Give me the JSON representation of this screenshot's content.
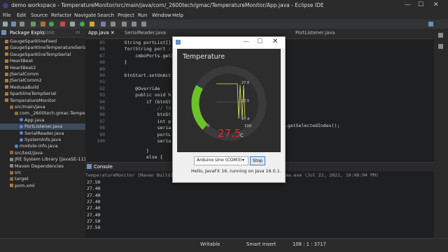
{
  "window": {
    "title": "demo workspace - TemperatureMonitor/src/main/java/com/_2600tech/gmac/TemperatureMonitor/App.java - Eclipse IDE"
  },
  "menu": [
    "File",
    "Edit",
    "Source",
    "Refactor",
    "Navigate",
    "Search",
    "Project",
    "Run",
    "Window",
    "Help"
  ],
  "left_panel": {
    "tab_label": "Package Explo",
    "tab2_label": "JUnit",
    "tree": [
      {
        "label": "GaugeSparklineFeed",
        "indent": 1,
        "icon": "project"
      },
      {
        "label": "GaugeSparklineTemperatureSerial",
        "indent": 1,
        "icon": "project"
      },
      {
        "label": "GaugeSparklineTempSerial",
        "indent": 1,
        "icon": "project"
      },
      {
        "label": "HeartBeat",
        "indent": 1,
        "icon": "project"
      },
      {
        "label": "HeartBeat2",
        "indent": 1,
        "icon": "project"
      },
      {
        "label": "JSerialComm",
        "indent": 1,
        "icon": "project"
      },
      {
        "label": "JSerialComm2",
        "indent": 1,
        "icon": "project"
      },
      {
        "label": "MedusaBuild",
        "indent": 1,
        "icon": "project"
      },
      {
        "label": "SparklineTempSerial",
        "indent": 1,
        "icon": "project"
      },
      {
        "label": "TemperatureMonitor",
        "indent": 1,
        "icon": "project"
      },
      {
        "label": "src/main/java",
        "indent": 2,
        "icon": "src"
      },
      {
        "label": "com._2600tech.gmac.Tempera",
        "indent": 3,
        "icon": "src"
      },
      {
        "label": "App.java",
        "indent": 4,
        "icon": "java"
      },
      {
        "label": "PortListener.java",
        "indent": 4,
        "icon": "java",
        "selected": true
      },
      {
        "label": "SerialReader.java",
        "indent": 4,
        "icon": "java"
      },
      {
        "label": "SystemInfo.java",
        "indent": 4,
        "icon": "java"
      },
      {
        "label": "module-info.java",
        "indent": 3,
        "icon": "java"
      },
      {
        "label": "src/test/java",
        "indent": 2,
        "icon": "src"
      },
      {
        "label": "JRE System Library [JavaSE-11]",
        "indent": 2,
        "icon": "lib"
      },
      {
        "label": "Maven Dependencies",
        "indent": 2,
        "icon": "lib"
      },
      {
        "label": "src",
        "indent": 2,
        "icon": "src"
      },
      {
        "label": "target",
        "indent": 2,
        "icon": "src"
      },
      {
        "label": "pom.xml",
        "indent": 2,
        "icon": "file"
      }
    ]
  },
  "editor": {
    "tabs": [
      "App.java",
      "SerialReader.java",
      "PortListener.java"
    ],
    "line_numbers": [
      "85",
      "86",
      "87",
      "88",
      "89",
      "90",
      "91",
      "92",
      "93",
      "94",
      "95",
      "96",
      "97",
      "98",
      "99",
      "100"
    ],
    "lines": [
      "    String portList[]",
      "    for(String port :",
      "        cmboPorts.getI",
      "    }",
      "",
      "    btnStart.setOnAct",
      "",
      "        @Override",
      "        public void h",
      "            if (btnSt",
      "                // TO",
      "                btnSt",
      "                int p",
      "                seria",
      "                portL",
      "                seria"
    ],
    "trailing_code": ".getSelectedIndex();",
    "line_end": "            }",
    "else_line": "            else {"
  },
  "console": {
    "tab_label": "Console",
    "header": "TemperatureMonitor [Maven Build] C:\\Program Files\\Java\\jdk-16.0.1\\bin\\javaw.exe (Jul 22, 2021, 10:08:04 PM)",
    "lines": [
      "27.50",
      "27.40",
      "27.40",
      "27.40",
      "27.40",
      "27.40",
      "27.50",
      "27.50"
    ]
  },
  "dialog": {
    "app_title": "Temperature",
    "gauge": {
      "value": 27.5,
      "unit": "C",
      "min_label": "0",
      "max_label": "100",
      "fill_fraction": 0.275,
      "sparkline_labels": [
        "27.6",
        "27.5",
        "27.4"
      ],
      "colors": {
        "arc_fill": "#6cc22a",
        "arc_track": "#3a3a3a",
        "value": "#e8272a",
        "bg": "#2d2d2d",
        "spark": "#e3e35a"
      }
    },
    "port_select": "Arduino Uno (COM3)",
    "stop_button": "Stop",
    "info": "Hello, JavaFX 16, running on Java 16.0.1."
  },
  "status": {
    "writable": "Writable",
    "insert": "Smart Insert",
    "position": "108 : 1 : 3717"
  }
}
